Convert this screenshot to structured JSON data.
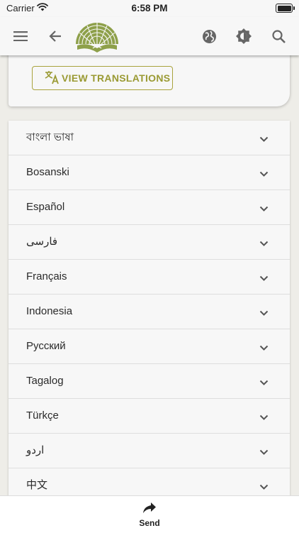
{
  "status_bar": {
    "carrier": "Carrier",
    "time": "6:58 PM"
  },
  "app_bar": {
    "icons": [
      "menu-icon",
      "back-arrow-icon",
      "app-logo",
      "globe-icon",
      "brightness-icon",
      "search-icon"
    ]
  },
  "card": {
    "view_translations_label": "VIEW TRANSLATIONS"
  },
  "languages": [
    "বাংলা ভাষা",
    "Bosanski",
    "Español",
    "فارسی",
    "Français",
    "Indonesia",
    "Русский",
    "Tagalog",
    "Türkçe",
    "اردو",
    "中文"
  ],
  "bottom_bar": {
    "send_label": "Send"
  },
  "colors": {
    "accent": "#a9a33d",
    "accent_text": "#9a9a33",
    "logo_green": "#8ea04a",
    "background": "#eeede8",
    "surface": "#f7f7f7"
  }
}
